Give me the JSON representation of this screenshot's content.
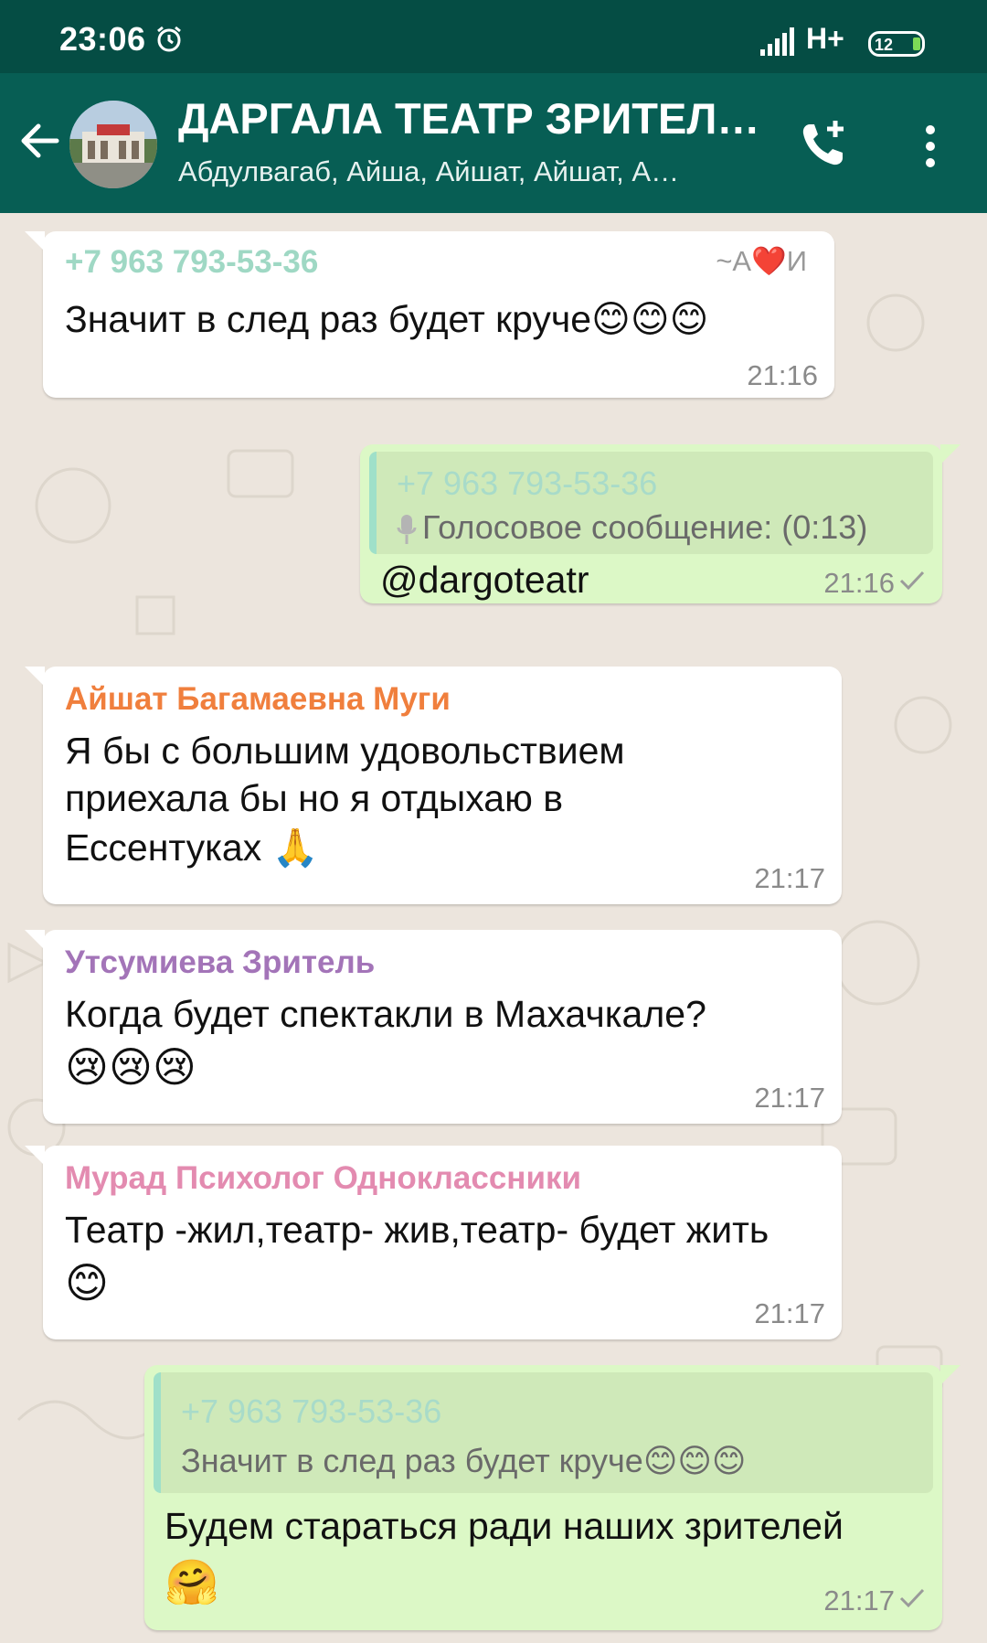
{
  "status_bar": {
    "time": "23:06",
    "network": "H+",
    "battery_level": "12",
    "icons": [
      "alarm-icon",
      "signal-icon",
      "battery-icon"
    ]
  },
  "header": {
    "title": "ДАРГАЛА ТЕАТР ЗРИТЕЛ…",
    "subtitle": "Абдулвагаб, Айша, Айшат, Айшат, А…",
    "icons": [
      "back-arrow-icon",
      "group-avatar",
      "add-call-icon",
      "more-vert-icon"
    ]
  },
  "colors": {
    "status_bar": "#054d44",
    "app_bar": "#075e54",
    "chat_background": "#ece5dd",
    "incoming_bubble": "#ffffff",
    "outgoing_bubble": "#dcf8c6",
    "sender_phone": "#9fd8c4",
    "sender_orange": "#f07f3d",
    "sender_purple": "#a374b8",
    "sender_pink": "#e38bb0",
    "timestamp": "#8a8a8a"
  },
  "messages": [
    {
      "direction": "incoming",
      "sender": "+7 963 793-53-36",
      "sender_nickname": "~А❤️И",
      "text": "Значит в след раз будет круче😊😊😊",
      "time": "21:16"
    },
    {
      "direction": "outgoing",
      "quoted_sender": "+7 963 793-53-36",
      "quoted_text": "Голосовое сообщение: (0:13)",
      "text": "@dargoteatr",
      "time": "21:16",
      "status": "sent"
    },
    {
      "direction": "incoming",
      "sender": "Айшат Багамаевна Муги",
      "text_lines": [
        "Я бы с большим удовольствием",
        "приехала бы но я отдыхаю в",
        "Ессентуках 🙏"
      ],
      "time": "21:17"
    },
    {
      "direction": "incoming",
      "sender": "Утсумиева Зритель",
      "text_lines": [
        "Когда будет спектакли в Махачкале?",
        "😢😢😢"
      ],
      "time": "21:17"
    },
    {
      "direction": "incoming",
      "sender": "Мурад Психолог Одноклассники",
      "text_lines": [
        "Театр -жил,театр- жив,театр- будет жить",
        "😊"
      ],
      "time": "21:17"
    },
    {
      "direction": "outgoing",
      "quoted_sender": "+7 963 793-53-36",
      "quoted_text": "Значит в след раз будет круче😊😊😊",
      "text_lines": [
        "Будем стараться ради наших зрителей",
        "🤗"
      ],
      "time": "21:17",
      "status": "sent"
    }
  ]
}
